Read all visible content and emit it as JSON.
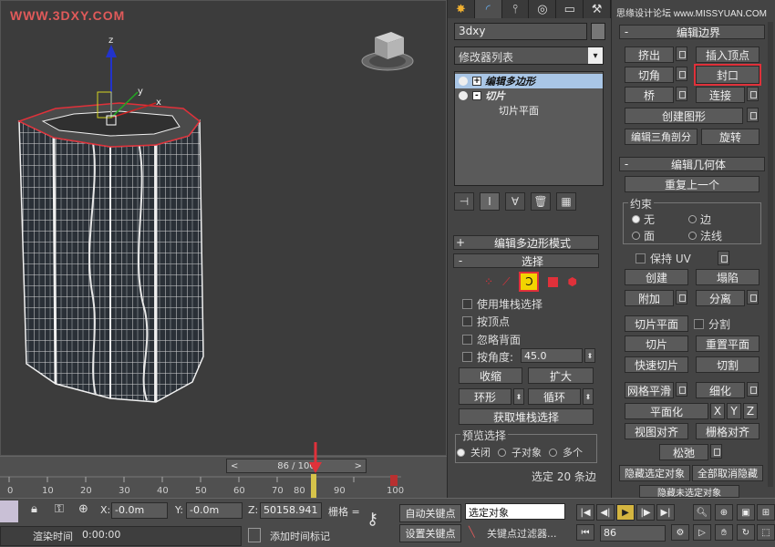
{
  "viewport": {
    "watermark": "WWW.3DXY.COM",
    "axis_labels": {
      "z": "z",
      "x": "x",
      "y": "y"
    }
  },
  "timeline": {
    "prev": "<",
    "frame_display": "86 / 100",
    "next": ">",
    "tick_labels": [
      "0",
      "10",
      "20",
      "30",
      "40",
      "50",
      "60",
      "70",
      "80",
      "90",
      "100"
    ]
  },
  "status": {
    "x_label": "X:",
    "x_value": "-0.0m",
    "y_label": "Y:",
    "y_value": "-0.0m",
    "z_label": "Z:",
    "z_value": "50158.941",
    "grid_label": "栅格 =",
    "render_time_label": "渲染时间",
    "render_time": "0:00:00",
    "add_time_tag": "添加时间标记",
    "auto_key": "自动关键点",
    "set_key": "设置关键点",
    "selection_dropdown": "选定对象",
    "key_filter": "关键点过滤器...",
    "frame_input": "86"
  },
  "command_panel": {
    "tabs": [
      "create",
      "modify",
      "hierarchy",
      "motion",
      "display",
      "utilities"
    ],
    "object_name": "3dxy",
    "modifier_list": "修改器列表",
    "stack": [
      {
        "label": "编辑多边形",
        "type": "modifier",
        "selected": true,
        "expander": "+"
      },
      {
        "label": "切片",
        "type": "modifier",
        "selected": false,
        "expander": "-"
      },
      {
        "label": "切片平面",
        "type": "subobject",
        "selected": false
      }
    ],
    "rollouts": {
      "edit_poly_mode": "编辑多边形模式",
      "selection": "选择",
      "use_stack_selection": "使用堆栈选择",
      "by_vertex": "按顶点",
      "ignore_backfacing": "忽略背面",
      "by_angle": "按角度:",
      "angle_value": "45.0",
      "shrink": "收缩",
      "grow": "扩大",
      "ring": "环形",
      "loop": "循环",
      "get_stack_selection": "获取堆栈选择",
      "preview_selection": "预览选择",
      "preview_off": "关闭",
      "preview_subobject": "子对象",
      "preview_multi": "多个",
      "selected_count": "选定 20 条边"
    }
  },
  "right_panel": {
    "watermark": "思缘设计论坛 www.MISSYUAN.COM",
    "edit_borders": "编辑边界",
    "extrude": "挤出",
    "insert_vertex": "插入顶点",
    "chamfer": "切角",
    "cap": "封口",
    "bridge": "桥",
    "connect": "连接",
    "create_shape": "创建图形",
    "edit_triangulation": "编辑三角剖分",
    "turn": "旋转",
    "edit_geometry": "编辑几何体",
    "repeat_last": "重复上一个",
    "constraints": "约束",
    "c_none": "无",
    "c_edge": "边",
    "c_face": "面",
    "c_normal": "法线",
    "preserve_uv": "保持 UV",
    "create": "创建",
    "collapse": "塌陷",
    "attach": "附加",
    "detach": "分离",
    "slice_plane": "切片平面",
    "split": "分割",
    "slice": "切片",
    "reset_plane": "重置平面",
    "quickslice": "快速切片",
    "cut": "切割",
    "meshsmooth": "网格平滑",
    "tessellate": "细化",
    "make_planar": "平面化",
    "x": "X",
    "y": "Y",
    "z": "Z",
    "view_align": "视图对齐",
    "grid_align": "栅格对齐",
    "relax": "松弛",
    "hide_selected": "隐藏选定对象",
    "unhide_all": "全部取消隐藏",
    "hide_unselected": "隐藏未选定对象"
  },
  "colors": {
    "highlight": "#e0313a",
    "selected_stack": "#a9c6e6",
    "marker_arrow": "#e0313a",
    "active_icon": "#f2d400"
  }
}
